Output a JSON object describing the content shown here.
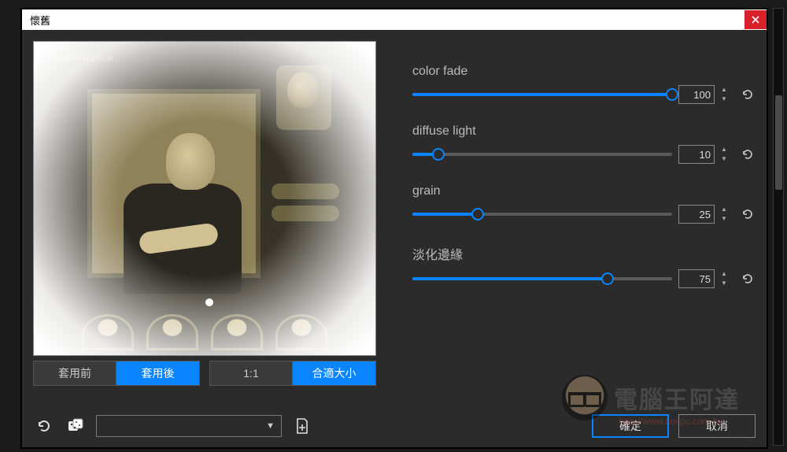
{
  "window": {
    "title": "懷舊"
  },
  "preview": {
    "brand": "Faceswapper.ai",
    "toggles": {
      "before": "套用前",
      "after": "套用後",
      "one_to_one": "1:1",
      "fit": "合適大小"
    }
  },
  "sliders": [
    {
      "label": "color fade",
      "value": 100,
      "max": 100
    },
    {
      "label": "diffuse light",
      "value": 10,
      "max": 100
    },
    {
      "label": "grain",
      "value": 25,
      "max": 100
    },
    {
      "label": "淡化邊緣",
      "value": 75,
      "max": 100
    }
  ],
  "buttons": {
    "ok": "確定",
    "cancel": "取消"
  },
  "preset": {
    "selected": ""
  },
  "watermark": {
    "text": "電腦王阿達",
    "url": "http://www.kocpc.com.tw"
  }
}
